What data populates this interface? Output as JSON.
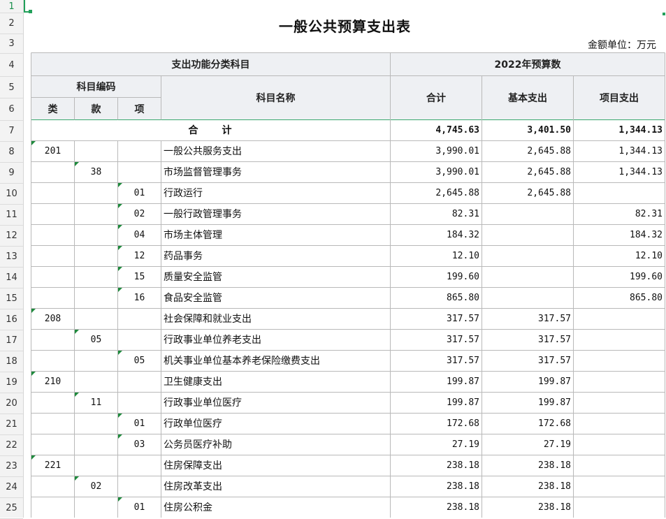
{
  "sheet": {
    "title": "一般公共预算支出表",
    "unit": "金额单位：万元",
    "row_numbers": [
      "1",
      "2",
      "3",
      "4",
      "5",
      "6",
      "7",
      "8",
      "9",
      "10",
      "11",
      "12",
      "13",
      "14",
      "15",
      "16",
      "17",
      "18",
      "19",
      "20",
      "21",
      "22",
      "23",
      "24",
      "25"
    ]
  },
  "header": {
    "group_function": "支出功能分类科目",
    "group_budget": "2022年预算数",
    "subject_code": "科目编码",
    "lei": "类",
    "kuan": "款",
    "xiang": "项",
    "subject_name": "科目名称",
    "total": "合计",
    "basic": "基本支出",
    "project": "项目支出"
  },
  "sum_row": {
    "label": "合　　计",
    "total": "4,745.63",
    "basic": "3,401.50",
    "project": "1,344.13"
  },
  "rows": [
    {
      "lei": "201",
      "kuan": "",
      "xiang": "",
      "name": "一般公共服务支出",
      "total": "3,990.01",
      "basic": "2,645.88",
      "project": "1,344.13"
    },
    {
      "lei": "",
      "kuan": "38",
      "xiang": "",
      "name": "市场监督管理事务",
      "total": "3,990.01",
      "basic": "2,645.88",
      "project": "1,344.13"
    },
    {
      "lei": "",
      "kuan": "",
      "xiang": "01",
      "name": "行政运行",
      "total": "2,645.88",
      "basic": "2,645.88",
      "project": ""
    },
    {
      "lei": "",
      "kuan": "",
      "xiang": "02",
      "name": "一般行政管理事务",
      "total": "82.31",
      "basic": "",
      "project": "82.31"
    },
    {
      "lei": "",
      "kuan": "",
      "xiang": "04",
      "name": "市场主体管理",
      "total": "184.32",
      "basic": "",
      "project": "184.32"
    },
    {
      "lei": "",
      "kuan": "",
      "xiang": "12",
      "name": "药品事务",
      "total": "12.10",
      "basic": "",
      "project": "12.10"
    },
    {
      "lei": "",
      "kuan": "",
      "xiang": "15",
      "name": "质量安全监管",
      "total": "199.60",
      "basic": "",
      "project": "199.60"
    },
    {
      "lei": "",
      "kuan": "",
      "xiang": "16",
      "name": "食品安全监管",
      "total": "865.80",
      "basic": "",
      "project": "865.80"
    },
    {
      "lei": "208",
      "kuan": "",
      "xiang": "",
      "name": "社会保障和就业支出",
      "total": "317.57",
      "basic": "317.57",
      "project": ""
    },
    {
      "lei": "",
      "kuan": "05",
      "xiang": "",
      "name": "行政事业单位养老支出",
      "total": "317.57",
      "basic": "317.57",
      "project": ""
    },
    {
      "lei": "",
      "kuan": "",
      "xiang": "05",
      "name": "机关事业单位基本养老保险缴费支出",
      "total": "317.57",
      "basic": "317.57",
      "project": ""
    },
    {
      "lei": "210",
      "kuan": "",
      "xiang": "",
      "name": "卫生健康支出",
      "total": "199.87",
      "basic": "199.87",
      "project": ""
    },
    {
      "lei": "",
      "kuan": "11",
      "xiang": "",
      "name": "行政事业单位医疗",
      "total": "199.87",
      "basic": "199.87",
      "project": ""
    },
    {
      "lei": "",
      "kuan": "",
      "xiang": "01",
      "name": "行政单位医疗",
      "total": "172.68",
      "basic": "172.68",
      "project": ""
    },
    {
      "lei": "",
      "kuan": "",
      "xiang": "03",
      "name": "公务员医疗补助",
      "total": "27.19",
      "basic": "27.19",
      "project": ""
    },
    {
      "lei": "221",
      "kuan": "",
      "xiang": "",
      "name": "住房保障支出",
      "total": "238.18",
      "basic": "238.18",
      "project": ""
    },
    {
      "lei": "",
      "kuan": "02",
      "xiang": "",
      "name": "住房改革支出",
      "total": "238.18",
      "basic": "238.18",
      "project": ""
    },
    {
      "lei": "",
      "kuan": "",
      "xiang": "01",
      "name": "住房公积金",
      "total": "238.18",
      "basic": "238.18",
      "project": ""
    }
  ],
  "colors": {
    "header_fill": "#eef0f3",
    "grid_line": "#b9b9b9",
    "accent_green": "#22a05a",
    "tick_green": "#1e8a3c"
  }
}
